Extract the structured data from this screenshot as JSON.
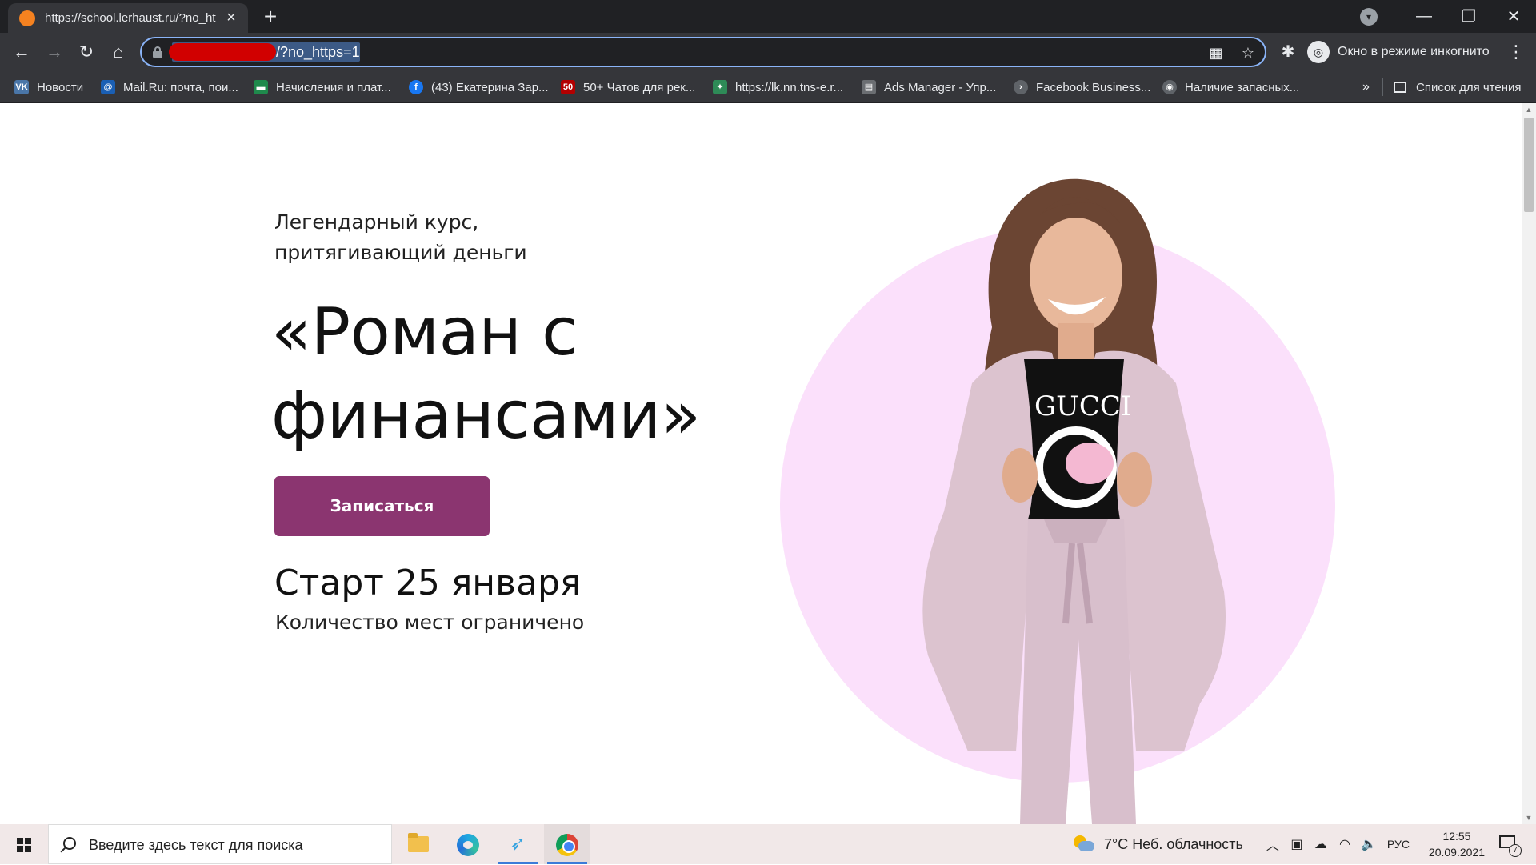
{
  "browser": {
    "tab": {
      "title": "https://school.lerhaust.ru/?no_https=1",
      "favicon": "site-favicon",
      "close_icon": "×"
    },
    "new_tab_icon": "+",
    "window_controls": {
      "tab_search": "▾",
      "minimize": "—",
      "restore": "❐",
      "close": "✕"
    },
    "nav": {
      "back": "←",
      "forward": "→",
      "reload": "↻",
      "home": "⌂"
    },
    "address_bar": {
      "url_visible": "/?no_https=1",
      "secure_icon": "lock-icon",
      "redacted": true
    },
    "omnibox_icons": {
      "qr": "▦",
      "bookmark_star": "☆"
    },
    "extensions_icon": "✱",
    "incognito": {
      "label": "Окно в режиме инкогнито",
      "icon": "◎"
    },
    "menu_icon": "⋮",
    "bookmarks": [
      {
        "label": "Новости",
        "icon_text": "VK",
        "icon_color": "#4a76a8"
      },
      {
        "label": "Mail.Ru: почта, пои...",
        "icon_text": "@",
        "icon_color": "#1a5fb4"
      },
      {
        "label": "Начисления и плат...",
        "icon_text": "▬",
        "icon_color": "#1f8a4c"
      },
      {
        "label": "(43) Екатерина Зар...",
        "icon_text": "f",
        "icon_color": "#1877f2"
      },
      {
        "label": "50+ Чатов для рек...",
        "icon_text": "50",
        "icon_color": "#b30000"
      },
      {
        "label": "https://lk.nn.tns-e.r...",
        "icon_text": "✦",
        "icon_color": "#2e8b57"
      },
      {
        "label": "Ads Manager - Упр...",
        "icon_text": "▤",
        "icon_color": "#6b6e72"
      },
      {
        "label": "Facebook Business...",
        "icon_text": "›",
        "icon_color": "#5f6368"
      },
      {
        "label": "Наличие запасных...",
        "icon_text": "◉",
        "icon_color": "#5f6368"
      }
    ],
    "bookmarks_more": "»",
    "reading_list": "Список для чтения"
  },
  "page": {
    "subtitle_line1": "Легендарный курс,",
    "subtitle_line2": "притягивающий деньги",
    "headline_line1": "«Роман с",
    "headline_line2": "финансами»",
    "cta_label": "Записаться",
    "start": "Старт 25 января",
    "seats": "Количество мест ограничено",
    "colors": {
      "cta": "#8b3570",
      "circle": "#fbe0fb",
      "text": "#111111"
    }
  },
  "taskbar": {
    "search_placeholder": "Введите здесь текст для поиска",
    "apps": [
      "file-explorer",
      "edge",
      "messenger",
      "chrome"
    ],
    "weather": "7°C  Неб. облачность",
    "tray_icons": {
      "chevron": "︿",
      "meet": "▣",
      "onedrive": "☁",
      "wifi": "◠",
      "volume": "🔈"
    },
    "language": "РУС",
    "time": "12:55",
    "date": "20.09.2021",
    "notifications_count": "7"
  }
}
